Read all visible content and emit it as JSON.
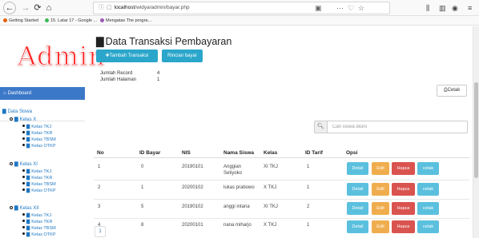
{
  "browser": {
    "url_host": "localhost",
    "url_path": "/widya/admin/bayar.php",
    "bookmarks": [
      "Getting Started",
      "15. Latar 17 - Google ...",
      "Mengatas The progra..."
    ]
  },
  "sidebar": {
    "brand": "Admin",
    "active_item": "Dashboard",
    "section_label": "Data Siswa",
    "groups": [
      {
        "label": "Kelas X",
        "items": [
          "Kelas TKJ",
          "Kelas TKR",
          "Kelas TBSM",
          "Kelas OTKP"
        ]
      },
      {
        "label": "Kelas XI",
        "items": [
          "Kelas TKJ",
          "Kelas TKR",
          "Kelas TBSM",
          "Kelas OTKP"
        ]
      },
      {
        "label": "Kelas XII",
        "items": [
          "Kelas TKJ",
          "Kelas TKR",
          "Kelas TBSM",
          "Kelas OTKP"
        ]
      }
    ]
  },
  "main": {
    "title": "Data Transaksi Pembayaran",
    "add_button": "Tambah Transaksi",
    "detail_button": "Rincian bayar",
    "summary": {
      "record_label": "Jumlah Record",
      "record_value": "4",
      "page_label": "Jumlah Halaman",
      "page_value": "1"
    },
    "print_button": "Cetak",
    "search_placeholder": "Cari siswa disini",
    "table": {
      "headers": [
        "No",
        "ID Bayar",
        "NIS",
        "Nama Siswa",
        "Kelas",
        "ID Tarif",
        "Opsi"
      ],
      "rows": [
        [
          "1",
          "0",
          "20190101",
          "Anggian Setiyoko",
          "XI TKJ",
          "1"
        ],
        [
          "2",
          "1",
          "20200102",
          "lukas prabowo",
          "X TKJ",
          "1"
        ],
        [
          "3",
          "5",
          "20190102",
          "anggi intana",
          "XI TKJ",
          "2"
        ],
        [
          "4",
          "8",
          "20200101",
          "nana miharjo",
          "X TKJ",
          "1"
        ]
      ],
      "actions": [
        "Detail",
        "Edit",
        "Hapus",
        "cetak"
      ]
    },
    "pagination": [
      "1"
    ]
  }
}
